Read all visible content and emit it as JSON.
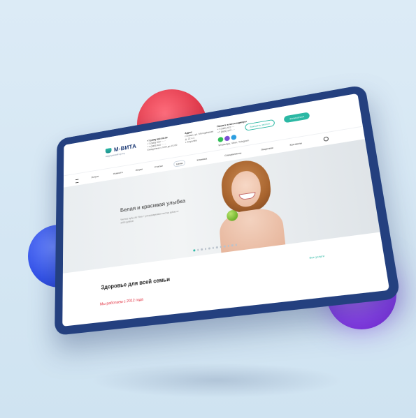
{
  "logo": {
    "name": "М-ВИТА",
    "subtitle": "медицинский центр"
  },
  "header": {
    "phones": [
      "+7 (495) 922-09-09",
      "+7 (985) 922 ··· ··",
      "+7 (985) 922 ··· ··"
    ],
    "hours": "Ежедневно с 9:00 до 21:00",
    "address_label": "Адрес",
    "address_lines": [
      "г.Химки, ул. Молодёжная",
      "д. 22 с.1",
      "г. Королёв"
    ],
    "messenger_label": "Пишите в мессенджеры",
    "messenger_phones": [
      "+7 (985) 922 ···",
      "+7 (985) 922 ···"
    ],
    "messenger_note": "WhatsApp, Viber, Telegram",
    "call_button": "Заказать звонок",
    "appointment_button": "Записаться"
  },
  "nav": {
    "items": [
      "Услуги",
      "Новости",
      "Акции",
      "Статьи",
      "Цены",
      "Клиника",
      "Специалисты",
      "Лицензии",
      "Контакты"
    ],
    "active_index": 4
  },
  "hero": {
    "title": "Белая и красивая улыбка",
    "subtitle": "Чистые зубы Air Flow + ультразвуковая чистка зубов от 3000 рублей",
    "slides": 12,
    "active_slide": 0
  },
  "section": {
    "title": "Здоровье для всей семьи",
    "link": "Все услуги",
    "since": "Мы работаем с 2012 года"
  },
  "colors": {
    "accent": "#2bb8a4",
    "frame": "#24407f",
    "red": "#e02a3a"
  },
  "icons": [
    "menu-icon",
    "search-icon",
    "whatsapp-icon",
    "viber-icon",
    "telegram-icon",
    "phone-icon"
  ]
}
